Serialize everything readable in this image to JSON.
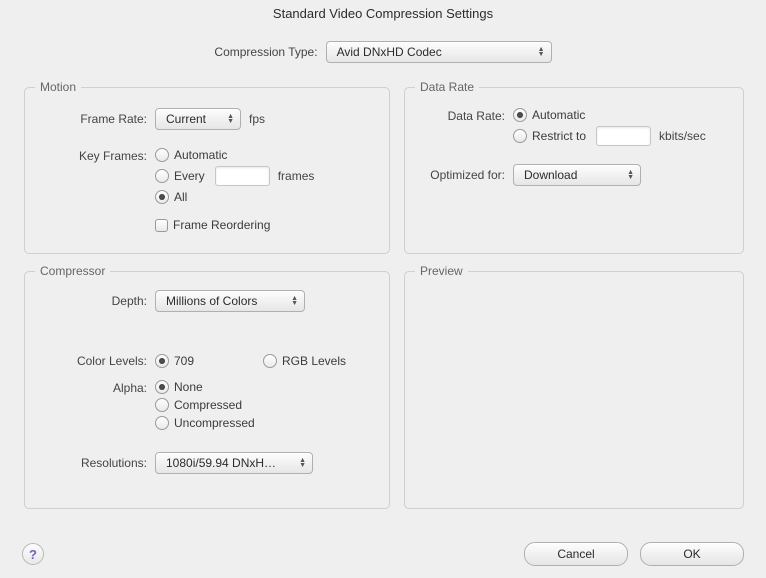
{
  "window": {
    "title": "Standard Video Compression Settings"
  },
  "compression_type": {
    "label": "Compression Type:",
    "value": "Avid DNxHD Codec"
  },
  "motion": {
    "legend": "Motion",
    "frame_rate_label": "Frame Rate:",
    "frame_rate_value": "Current",
    "frame_rate_unit": "fps",
    "key_frames_label": "Key Frames:",
    "key_frames_options": {
      "automatic": "Automatic",
      "every": "Every",
      "all": "All"
    },
    "key_frames_selected": "all",
    "every_suffix": "frames",
    "frame_reordering_label": "Frame Reordering",
    "frame_reordering_checked": false
  },
  "data_rate": {
    "legend": "Data Rate",
    "data_rate_label": "Data Rate:",
    "options": {
      "automatic": "Automatic",
      "restrict": "Restrict to"
    },
    "selected": "automatic",
    "restrict_unit": "kbits/sec",
    "optimized_label": "Optimized for:",
    "optimized_value": "Download"
  },
  "compressor": {
    "legend": "Compressor",
    "depth_label": "Depth:",
    "depth_value": "Millions of Colors",
    "color_levels_label": "Color Levels:",
    "color_levels_options": {
      "r709": "709",
      "rgb": "RGB Levels"
    },
    "color_levels_selected": "r709",
    "alpha_label": "Alpha:",
    "alpha_options": {
      "none": "None",
      "compressed": "Compressed",
      "uncompressed": "Uncompressed"
    },
    "alpha_selected": "none",
    "resolutions_label": "Resolutions:",
    "resolutions_value": "1080i/59.94  DNxH…"
  },
  "preview": {
    "legend": "Preview"
  },
  "buttons": {
    "cancel": "Cancel",
    "ok": "OK"
  }
}
